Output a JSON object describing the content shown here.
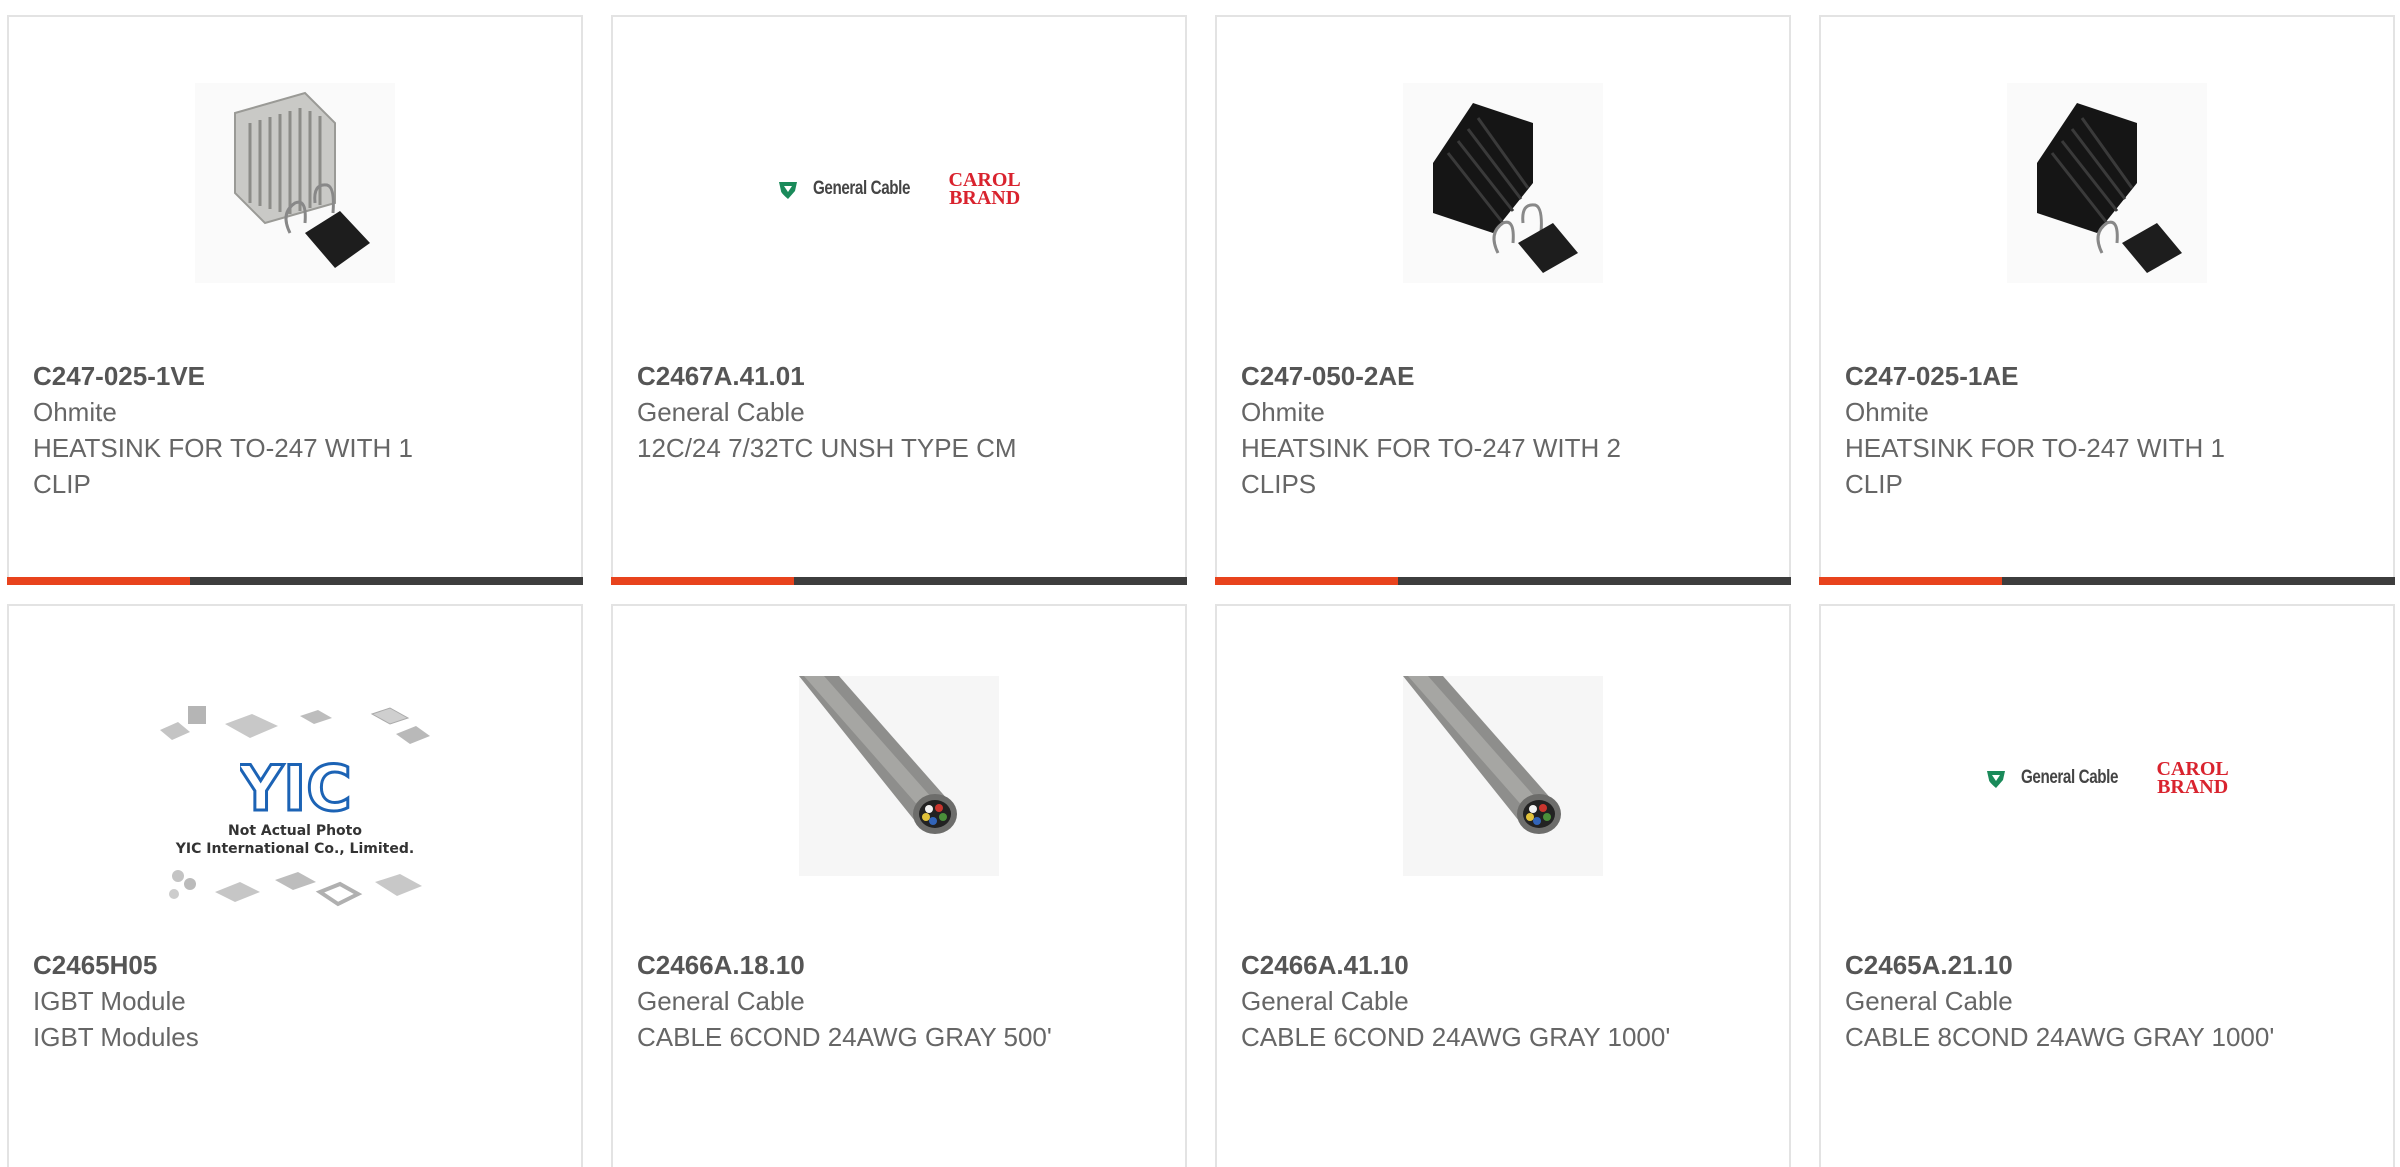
{
  "products": [
    {
      "part": "C247-025-1VE",
      "manufacturer": "Ohmite",
      "description": "HEATSINK FOR TO-247 WITH 1 CLIP",
      "image": "heatsink-silver-with-clip"
    },
    {
      "part": "C2467A.41.01",
      "manufacturer": "General Cable",
      "description": "12C/24 7/32TC UNSH TYPE CM",
      "image": "general-cable-carol-brand-logo"
    },
    {
      "part": "C247-050-2AE",
      "manufacturer": "Ohmite",
      "description": "HEATSINK FOR TO-247 WITH 2 CLIPS",
      "image": "heatsink-black-with-clips"
    },
    {
      "part": "C247-025-1AE",
      "manufacturer": "Ohmite",
      "description": "HEATSINK FOR TO-247 WITH 1 CLIP",
      "image": "heatsink-black-with-clip"
    },
    {
      "part": "C2465H05",
      "manufacturer": "IGBT Module",
      "description": "IGBT Modules",
      "image": "yic-not-actual-photo"
    },
    {
      "part": "C2466A.18.10",
      "manufacturer": "General Cable",
      "description": "CABLE 6COND 24AWG GRAY 500'",
      "image": "gray-cable-photo"
    },
    {
      "part": "C2466A.41.10",
      "manufacturer": "General Cable",
      "description": "CABLE 6COND 24AWG GRAY 1000'",
      "image": "gray-cable-photo"
    },
    {
      "part": "C2465A.21.10",
      "manufacturer": "General Cable",
      "description": "CABLE 8COND 24AWG GRAY 1000'",
      "image": "general-cable-carol-brand-logo"
    }
  ],
  "logos": {
    "general_cable": "General Cable",
    "carol_line1": "CAROL",
    "carol_line2": "BRAND",
    "yic_mark": "YIC",
    "yic_caption_line1": "Not Actual Photo",
    "yic_caption_line2": "YIC International Co., Limited."
  },
  "colors": {
    "accent": "#e8431d",
    "bar": "#3d3d3d",
    "border": "#e3e3e3",
    "part_text": "#555555",
    "body_text": "#666666",
    "carol_red": "#d9232e",
    "general_cable_green": "#1a8a5a"
  }
}
